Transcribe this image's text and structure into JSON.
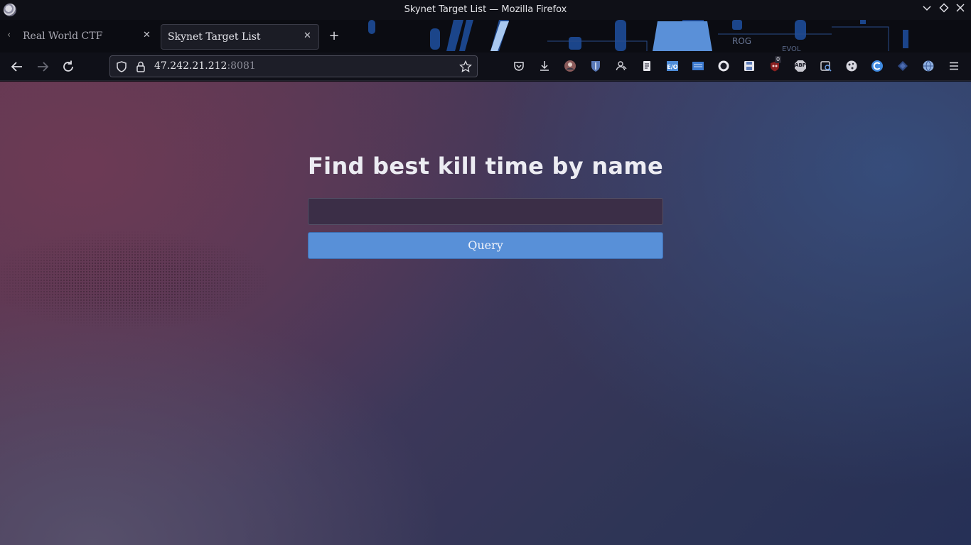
{
  "window": {
    "title": "Skynet Target List — Mozilla Firefox",
    "controls": [
      "chevron-down-icon",
      "diamond-icon",
      "close-icon"
    ]
  },
  "tabs": [
    {
      "label": "Real World CTF",
      "active": false
    },
    {
      "label": "Skynet Target List",
      "active": true
    }
  ],
  "toolbar": {
    "url_host": "47.242.21.212",
    "url_port": ":8081",
    "extensions": [
      "pocket-icon",
      "download-icon",
      "ext-avatar-icon",
      "bitwarden-icon",
      "ext-user-icon",
      "reader-icon",
      "ext-eo-icon",
      "ext-news-icon",
      "ext-ring-icon",
      "ext-save-icon",
      "ublock-icon",
      "adblock-plus-icon",
      "ext-search-icon",
      "ext-cookie-icon",
      "ext-c-icon",
      "ext-diamond-icon",
      "ext-globe-icon",
      "menu-icon"
    ],
    "ublock_badge": "0",
    "abp_label": "ABP"
  },
  "page": {
    "heading": "Find best kill time by name",
    "input_value": "",
    "button_label": "Query"
  },
  "colors": {
    "accent": "#5890d8",
    "input_bg": "#3b2e47"
  }
}
